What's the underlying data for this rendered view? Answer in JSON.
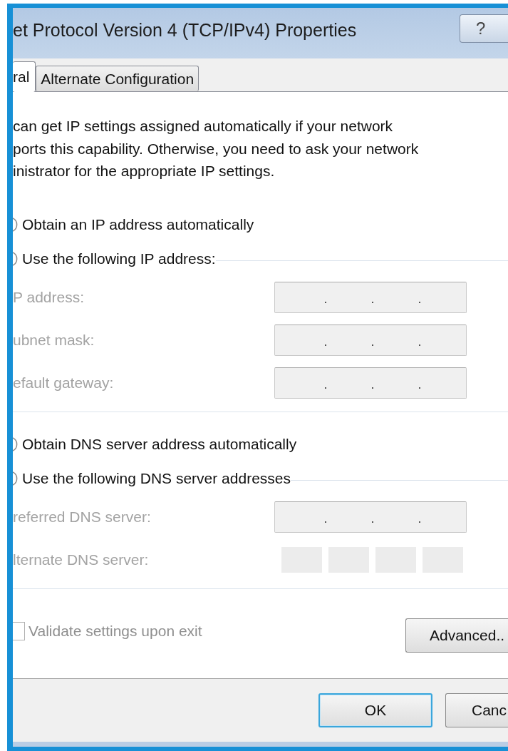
{
  "window": {
    "title": "et Protocol Version 4 (TCP/IPv4) Properties",
    "help_button": "?"
  },
  "tabs": [
    {
      "label": "ral",
      "selected": true
    },
    {
      "label": "Alternate Configuration",
      "selected": false
    }
  ],
  "description": "can get IP settings assigned automatically if your network\nports this capability. Otherwise, you need to ask your network\ninistrator for the appropriate IP settings.",
  "sections": [
    {
      "options": [
        {
          "label": "Obtain an IP address automatically",
          "group_line": false
        },
        {
          "label": "Use the following IP address:",
          "group_line": true
        }
      ],
      "fields": [
        {
          "label": "P address:",
          "kind": "ip",
          "disabled": true
        },
        {
          "label": "ubnet mask:",
          "kind": "ip",
          "disabled": true
        },
        {
          "label": "efault gateway:",
          "kind": "ip",
          "disabled": true
        }
      ]
    },
    {
      "options": [
        {
          "label": "Obtain DNS server address automatically",
          "group_line": false
        },
        {
          "label": "Use the following DNS server addresses",
          "group_line": true
        }
      ],
      "fields": [
        {
          "label": "referred DNS server:",
          "kind": "ip",
          "disabled": true
        },
        {
          "label": "lternate DNS server:",
          "kind": "segments",
          "disabled": true
        }
      ]
    }
  ],
  "validate": {
    "label": "Validate settings upon exit",
    "checked": false,
    "disabled": true
  },
  "advanced_button": "Advanced..",
  "footer_buttons": [
    {
      "label": "OK",
      "default": true
    },
    {
      "label": "Canc",
      "default": false
    }
  ]
}
